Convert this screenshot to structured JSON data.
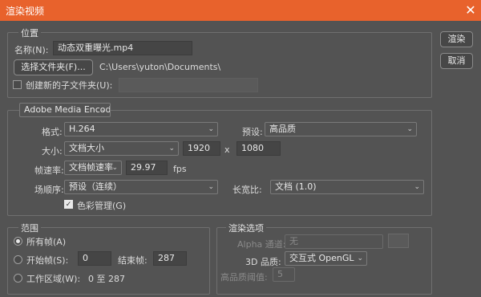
{
  "window": {
    "title": "渲染视频"
  },
  "buttons": {
    "render": "渲染",
    "cancel": "取消"
  },
  "location": {
    "legend": "位置",
    "name_label": "名称(N):",
    "name_value": "动态双重曝光.mp4",
    "select_folder": "选择文件夹(F)...",
    "path": "C:\\Users\\yuton\\Documents\\",
    "subfolder_label": "创建新的子文件夹(U):",
    "subfolder_value": ""
  },
  "encoder": {
    "selected": "Adobe Media Encoder",
    "format_label": "格式:",
    "format_value": "H.264",
    "preset_label": "预设:",
    "preset_value": "高品质",
    "size_label": "大小:",
    "size_value": "文档大小",
    "width": "1920",
    "x_sep": "x",
    "height": "1080",
    "framerate_label": "帧速率:",
    "framerate_value": "文档帧速率",
    "fps_value": "29.97",
    "fps_unit": "fps",
    "field_order_label": "场顺序:",
    "field_order_value": "预设（连续）",
    "aspect_label": "长宽比:",
    "aspect_value": "文档 (1.0)",
    "color_mgmt_label": "色彩管理(G)",
    "color_mgmt_checked": true
  },
  "range": {
    "legend": "范围",
    "all_frames": "所有帧(A)",
    "start_frame_label": "开始帧(S):",
    "start_frame": "0",
    "end_frame_label": "结束帧:",
    "end_frame": "287",
    "work_area_label": "工作区域(W):",
    "work_area_value": "0 至 287",
    "selected": "all_frames"
  },
  "render_options": {
    "legend": "渲染选项",
    "alpha_label": "Alpha 通道:",
    "alpha_value": "无",
    "quality_3d_label": "3D 品质:",
    "quality_3d_value": "交互式 OpenGL",
    "threshold_label": "高品质阈值:",
    "threshold_value": "5"
  }
}
